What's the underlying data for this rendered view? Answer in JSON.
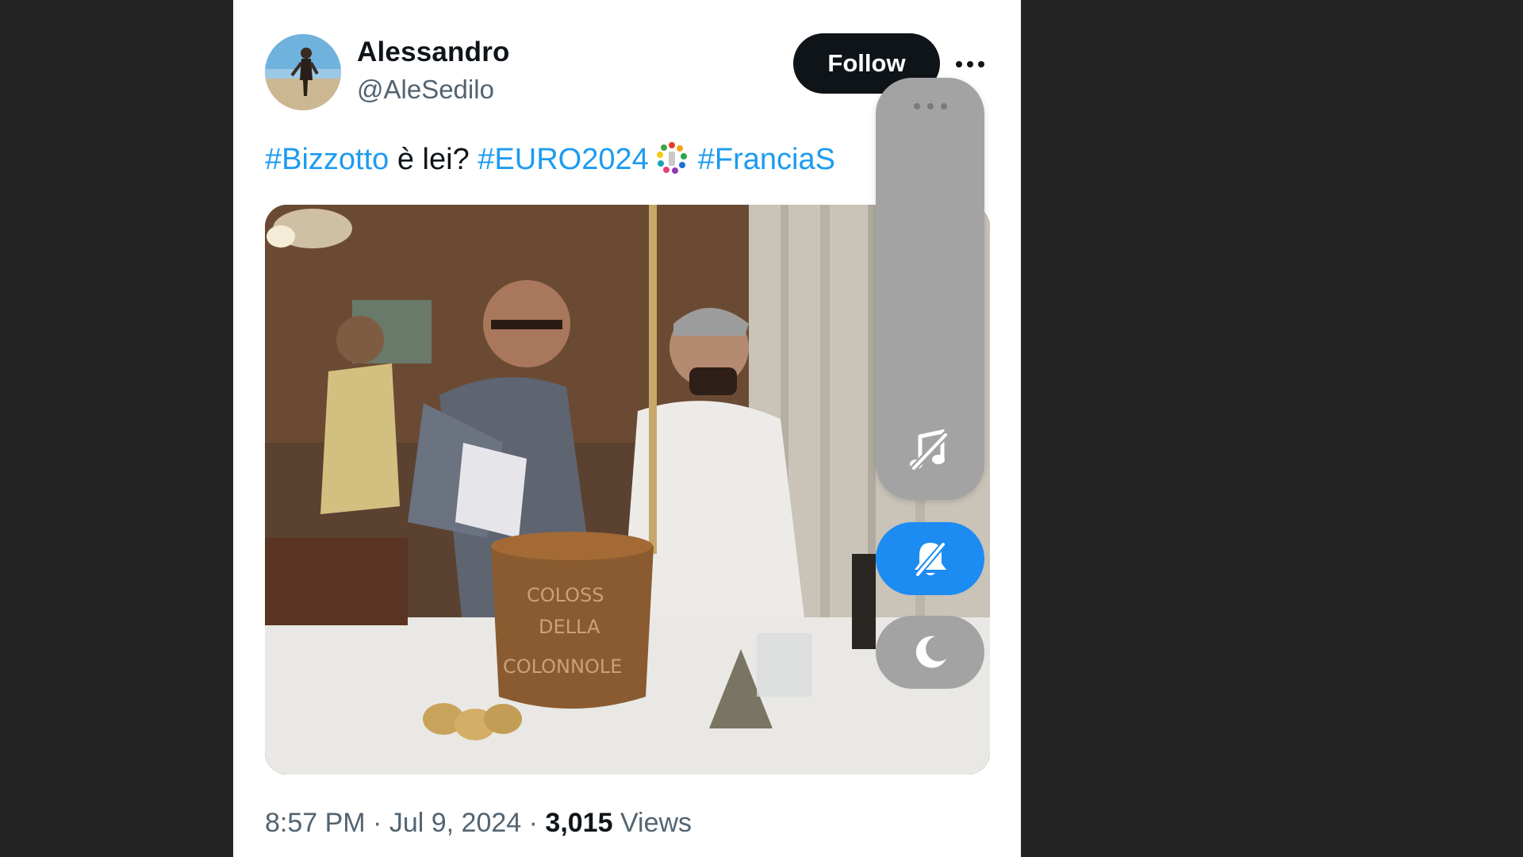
{
  "tweet": {
    "author_name": "Alessandro",
    "author_handle": "@AleSedilo",
    "follow_label": "Follow",
    "text": {
      "tag1": "#Bizzotto",
      "plain": " è lei? ",
      "tag2": "#EURO2024",
      "tag3": "#FranciaS"
    },
    "media_alt": "GIF of two men at a dinner table with a copper pot",
    "time": "8:57 PM",
    "separator": " · ",
    "date": "Jul 9, 2024",
    "views_count": "3,015",
    "views_label": "Views"
  },
  "side_panel": {
    "icons": [
      "more-dots-icon",
      "music-off-icon",
      "bell-off-icon",
      "moon-icon"
    ],
    "accent_color": "#1d8cf2",
    "panel_color": "#a3a3a3"
  },
  "colors": {
    "background": "#242424",
    "link": "#1d9bf0",
    "text": "#0f1419",
    "secondary": "#536471"
  }
}
